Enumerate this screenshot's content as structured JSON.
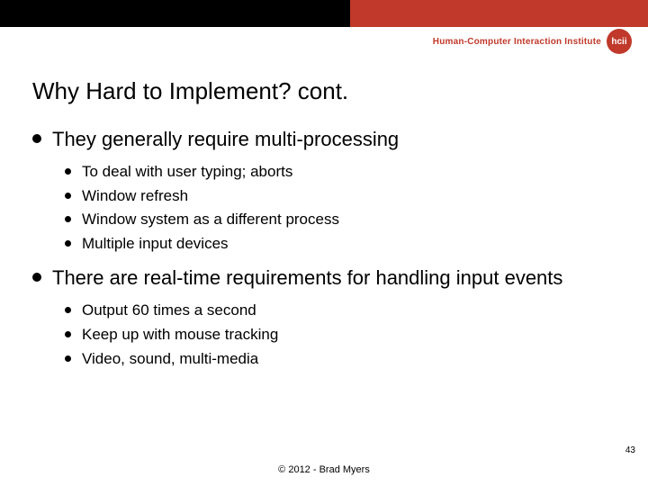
{
  "header": {
    "institute_text": "Human-Computer Interaction Institute",
    "institute_logo_text": "hcii"
  },
  "title": "Why Hard to Implement? cont.",
  "bullets": [
    {
      "text": "They generally require multi-processing",
      "sub": [
        "To deal with user typing; aborts",
        "Window refresh",
        "Window system as a different process",
        "Multiple input devices"
      ]
    },
    {
      "text": "There are real-time requirements for handling input events",
      "sub": [
        "Output 60 times a second",
        "Keep up with mouse tracking",
        "Video, sound, multi-media"
      ]
    }
  ],
  "page_number": "43",
  "copyright": "© 2012 - Brad Myers"
}
